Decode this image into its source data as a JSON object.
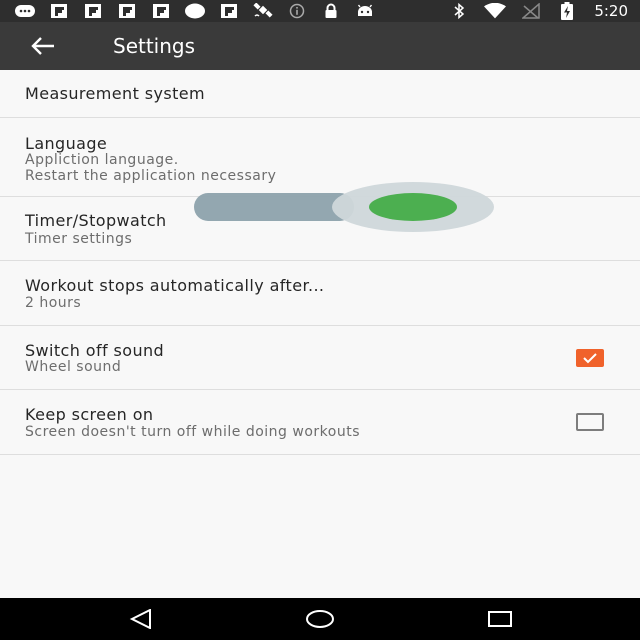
{
  "status_bar": {
    "time": "5:20",
    "left_icons": [
      "chat-bubble-icon",
      "flipboard-icon",
      "flipboard-icon",
      "flipboard-icon",
      "flipboard-icon",
      "circle-icon",
      "flipboard-icon",
      "satellite-icon",
      "info-icon",
      "lock-icon",
      "android-icon"
    ],
    "right_icons": [
      "bluetooth-icon",
      "wifi-icon",
      "no-signal-icon",
      "battery-charging-icon"
    ]
  },
  "toolbar": {
    "title": "Settings"
  },
  "settings": [
    {
      "title": "Measurement system"
    },
    {
      "title": "Language",
      "subtitle_line1": "Appliction language.",
      "subtitle_line2": "Restart the application necessary"
    },
    {
      "title": "Timer/Stopwatch",
      "subtitle": "Timer settings"
    },
    {
      "title": "Workout stops automatically after...",
      "subtitle": "2 hours"
    },
    {
      "title": "Switch off sound",
      "subtitle": "Wheel sound",
      "checked": true
    },
    {
      "title": "Keep screen on",
      "subtitle": "Screen doesn't turn off while doing workouts",
      "checked": false
    }
  ],
  "colors": {
    "accent": "#f0622b",
    "toolbar": "#3a3a3a",
    "status_bar": "#2e2e2e",
    "slider_thumb": "#4caf50",
    "slider_track": "#8fa4ad"
  },
  "slider": {
    "value": 1.0
  }
}
